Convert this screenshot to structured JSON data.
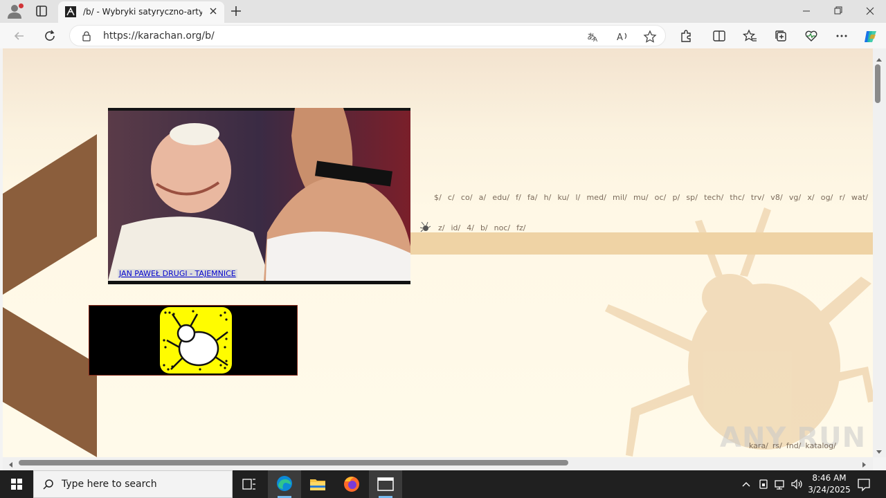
{
  "browser": {
    "tab_title": "/b/ - Wybryki satyryczno-artystyczne",
    "url": "https://karachan.org/b/",
    "icons": {
      "profile": "profile-icon",
      "tabs": "tab-actions-icon",
      "new_tab": "plus-icon",
      "back": "back-arrow-icon",
      "refresh": "refresh-icon",
      "lock": "lock-icon",
      "translate": "translate-icon",
      "read_aloud": "read-aloud-icon",
      "favorite": "star-icon",
      "extensions": "puzzle-icon",
      "split": "split-screen-icon",
      "favorites": "favorites-icon",
      "collections": "collections-icon",
      "browser_essentials": "heart-pulse-icon",
      "more": "more-icon",
      "copilot": "copilot-icon"
    }
  },
  "page": {
    "banner_caption": "JAN PAWEŁ DRUGI - TAJEMNICE",
    "board_nav_row1": [
      "$/",
      "c/",
      "co/",
      "a/",
      "edu/",
      "f/",
      "fa/",
      "h/",
      "ku/",
      "l/",
      "med/",
      "mil/",
      "mu/",
      "oc/",
      "p/",
      "sp/",
      "tech/",
      "thc/",
      "trv/",
      "v8/",
      "vg/",
      "x/",
      "og/",
      "r/",
      "wat/"
    ],
    "board_nav_row2": [
      "z/",
      "id/",
      "4/",
      "b/",
      "noc/",
      "fz/"
    ],
    "footer_nav": [
      "kara/",
      "rs/",
      "fnd/",
      "katalog/"
    ],
    "watermark": "ANY RUN",
    "colors": {
      "chevron": "#8b5e3c",
      "tan_bar": "#efd3a5",
      "link": "#0000cc",
      "snap_yellow": "#fffc00"
    }
  },
  "taskbar": {
    "search_placeholder": "Type here to search",
    "time": "8:46 AM",
    "date": "3/24/2025",
    "apps": [
      "task-view-icon",
      "edge-icon",
      "file-explorer-icon",
      "firefox-icon",
      "window-icon"
    ]
  }
}
